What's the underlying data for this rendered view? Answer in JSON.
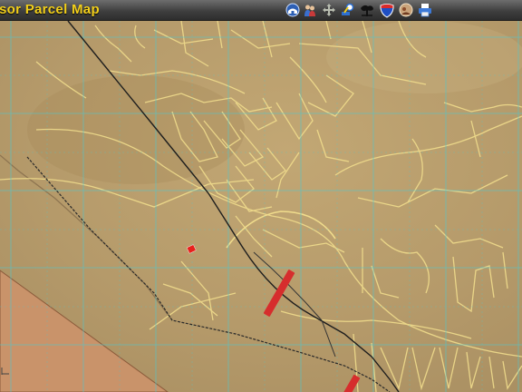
{
  "header": {
    "title": "sor Parcel Map"
  },
  "toolbar": {
    "tools": [
      {
        "name": "home-globe-icon"
      },
      {
        "name": "people-icon"
      },
      {
        "name": "pan-arrows-icon"
      },
      {
        "name": "identify-tool-icon"
      },
      {
        "name": "tree-icon"
      },
      {
        "name": "interstate-shield-icon"
      },
      {
        "name": "photo-icon"
      },
      {
        "name": "print-icon"
      }
    ]
  },
  "map": {
    "layer": "satellite",
    "colors": {
      "terrain": "#b59a6a",
      "parcel_lines": "#f0dc8c",
      "grid": "#4fc7cf",
      "railroad": "#1e1e1e",
      "highway": "#d62d2d",
      "selected_parcel": "#e8201c",
      "outside_area": "#c9936a"
    }
  }
}
